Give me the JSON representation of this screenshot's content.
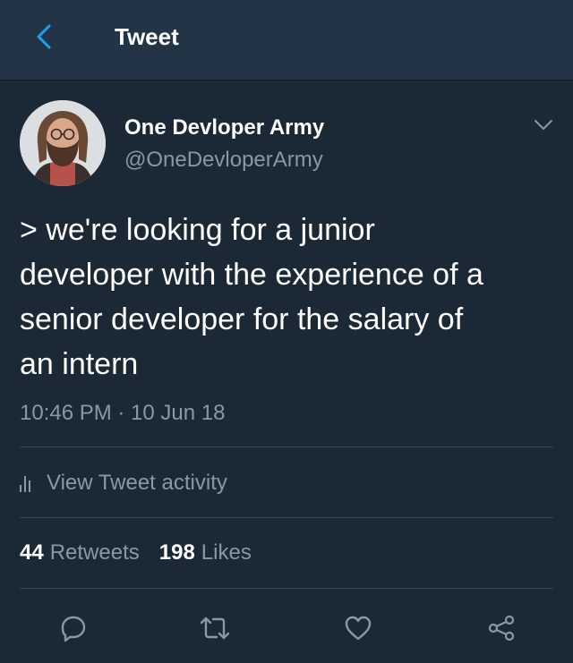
{
  "header": {
    "title": "Tweet",
    "back_icon": "chevron-left-icon"
  },
  "author": {
    "name": "One Devloper Army",
    "handle": "@OneDevloperArmy"
  },
  "tweet": {
    "text": "> we're looking for a junior\ndeveloper with the experience of a\nsenior developer for the salary of\nan intern",
    "timestamp": "10:46 PM · 10 Jun 18"
  },
  "activity": {
    "label": "View Tweet activity",
    "icon": "bar-chart-icon"
  },
  "stats": {
    "retweets_count": "44",
    "retweets_label": "Retweets",
    "likes_count": "198",
    "likes_label": "Likes"
  },
  "actions": [
    "reply-icon",
    "retweet-icon",
    "like-icon",
    "share-icon"
  ],
  "colors": {
    "background": "#1b2836",
    "header": "#243447",
    "accent": "#1da1f2",
    "secondary_text": "#8899a6",
    "divider": "#38444d"
  }
}
